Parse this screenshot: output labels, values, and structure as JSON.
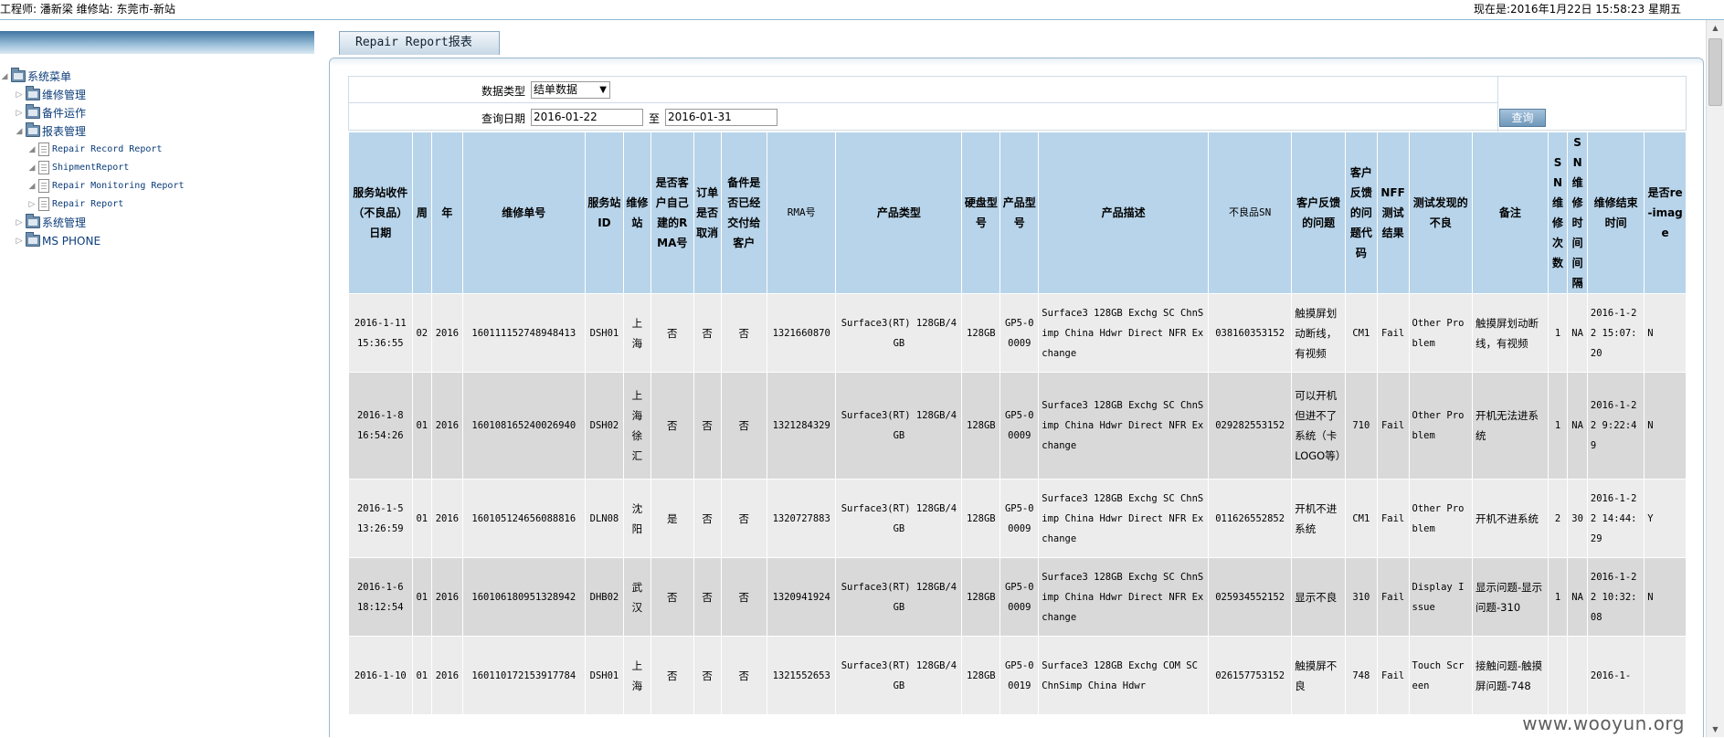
{
  "topbar": {
    "user_info": "工程师: 潘新梁   维修站: 东莞市-新站",
    "datetime": "现在是:2016年1月22日 15:58:23 星期五"
  },
  "sidebar": {
    "nodes": [
      {
        "label": "系统菜单",
        "level": 0,
        "kind": "folder",
        "expander": "◢"
      },
      {
        "label": "维修管理",
        "level": 1,
        "kind": "folder",
        "expander": "▷"
      },
      {
        "label": "备件运作",
        "level": 1,
        "kind": "folder",
        "expander": "▷"
      },
      {
        "label": "报表管理",
        "level": 1,
        "kind": "folder",
        "expander": "◢"
      },
      {
        "label": "Repair Record Report",
        "level": 2,
        "kind": "page",
        "expander": "◢"
      },
      {
        "label": "ShipmentReport",
        "level": 2,
        "kind": "page",
        "expander": "◢"
      },
      {
        "label": "Repair Monitoring Report",
        "level": 2,
        "kind": "page",
        "expander": "◢"
      },
      {
        "label": "Repair Report",
        "level": 2,
        "kind": "page",
        "expander": "▷"
      },
      {
        "label": "系统管理",
        "level": 1,
        "kind": "folder",
        "expander": "▷"
      },
      {
        "label": "MS PHONE",
        "level": 1,
        "kind": "folder",
        "expander": "▷"
      }
    ]
  },
  "tab": {
    "label": "Repair Report报表"
  },
  "filter": {
    "type_label": "数据类型",
    "type_value": "结单数据",
    "date_label": "查询日期",
    "date_from": "2016-01-22",
    "to_label": "至",
    "date_to": "2016-01-31",
    "query_button": "查询"
  },
  "table": {
    "headers": [
      "服务站收件（不良品）日期",
      "周",
      "年",
      "维修单号",
      "服务站ID",
      "维修站",
      "是否客户自己建的RMA号",
      "订单是否取消",
      "备件是否已经交付给客户",
      "RMA号",
      "产品类型",
      "硬盘型号",
      "产品型号",
      "产品描述",
      "不良品SN",
      "客户反馈的问题",
      "客户反馈的问题代码",
      "NFF测试结果",
      "测试发现的不良",
      "备注",
      "SN维修次数",
      "SN维修时间间隔",
      "维修结束时间",
      "是否re-image"
    ],
    "rows": [
      [
        "2016-1-11 15:36:55",
        "02",
        "2016",
        "160111152748948413",
        "DSH01",
        "上海",
        "否",
        "否",
        "否",
        "1321660870",
        "Surface3(RT) 128GB/4GB",
        "128GB",
        "GP5-00009",
        "Surface3 128GB Exchg SC ChnSimp China Hdwr Direct NFR Exchange",
        "038160353152",
        "触摸屏划动断线，有视频",
        "CM1",
        "Fail",
        "Other Problem",
        "触摸屏划动断线，有视频",
        "1",
        "NA",
        "2016-1-22 15:07:20",
        "N"
      ],
      [
        "2016-1-8 16:54:26",
        "01",
        "2016",
        "160108165240026940",
        "DSH02",
        "上海徐汇",
        "否",
        "否",
        "否",
        "1321284329",
        "Surface3(RT) 128GB/4GB",
        "128GB",
        "GP5-00009",
        "Surface3 128GB Exchg SC ChnSimp China Hdwr Direct NFR Exchange",
        "029282553152",
        "可以开机但进不了系统（卡LOGO等）",
        "710",
        "Fail",
        "Other Problem",
        "开机无法进系统",
        "1",
        "NA",
        "2016-1-22 9:22:49",
        "N"
      ],
      [
        "2016-1-5 13:26:59",
        "01",
        "2016",
        "160105124656088816",
        "DLN08",
        "沈阳",
        "是",
        "否",
        "否",
        "1320727883",
        "Surface3(RT) 128GB/4GB",
        "128GB",
        "GP5-00009",
        "Surface3 128GB Exchg SC ChnSimp China Hdwr Direct NFR Exchange",
        "011626552852",
        "开机不进系统",
        "CM1",
        "Fail",
        "Other Problem",
        "开机不进系统",
        "2",
        "30",
        "2016-1-22 14:44:29",
        "Y"
      ],
      [
        "2016-1-6 18:12:54",
        "01",
        "2016",
        "160106180951328942",
        "DHB02",
        "武汉",
        "否",
        "否",
        "否",
        "1320941924",
        "Surface3(RT) 128GB/4GB",
        "128GB",
        "GP5-00009",
        "Surface3 128GB Exchg SC ChnSimp China Hdwr Direct NFR Exchange",
        "025934552152",
        "显示不良",
        "310",
        "Fail",
        "Display Issue",
        "显示问题-显示问题-310",
        "1",
        "NA",
        "2016-1-22 10:32:08",
        "N"
      ],
      [
        "2016-1-10",
        "01",
        "2016",
        "160110172153917784",
        "DSH01",
        "上海",
        "否",
        "否",
        "否",
        "1321552653",
        "Surface3(RT) 128GB/4GB",
        "128GB",
        "GP5-00019",
        "Surface3 128GB Exchg COM SC ChnSimp China Hdwr",
        "026157753152",
        "触摸屏不良",
        "748",
        "Fail",
        "Touch Screen",
        "接触问题-触摸屏问题-748",
        "",
        "",
        "2016-1-",
        ""
      ]
    ]
  },
  "watermark": "www.wooyun.org"
}
